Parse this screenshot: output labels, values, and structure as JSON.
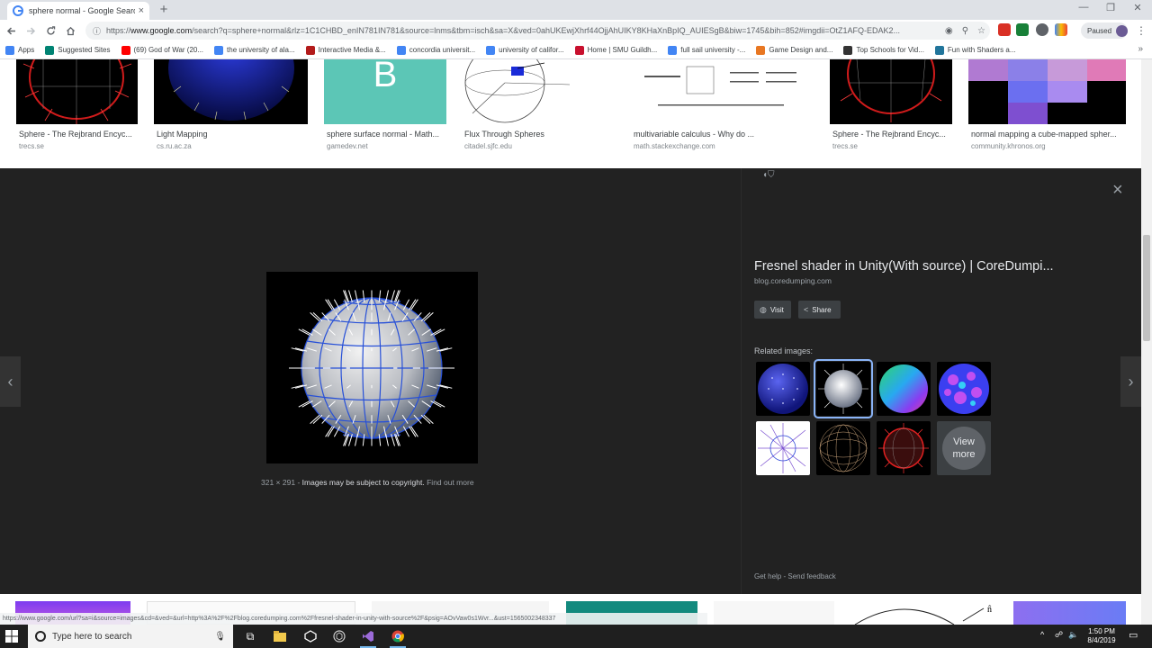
{
  "browser": {
    "tab_title": "sphere normal - Google Search",
    "tab_close": "×",
    "new_tab": "+",
    "window_controls": [
      "—",
      "❐",
      "✕"
    ],
    "url_prefix": "https://",
    "url_domain": "www.google.com",
    "url_rest": "/search?q=sphere+normal&rlz=1C1CHBD_enIN781IN781&source=lnms&tbm=isch&sa=X&ved=0ahUKEwjXhrf44OjjAhUIKY8KHaXnBpIQ_AUIESgB&biw=1745&bih=852#imgdii=OtZ1AFQ-EDAK2...",
    "profile_status": "Paused",
    "menu": "⋮"
  },
  "bookmarks": [
    {
      "label": "Apps",
      "icon": "apps-icon",
      "color": "#4285f4"
    },
    {
      "label": "Suggested Sites",
      "icon": "bing-icon",
      "color": "#008373"
    },
    {
      "label": "(69) God of War (20...",
      "icon": "youtube-icon",
      "color": "#ff0000"
    },
    {
      "label": "the university of ala...",
      "icon": "google-icon",
      "color": "#4285f4"
    },
    {
      "label": "Interactive Media &...",
      "icon": "w-icon",
      "color": "#b31b1b"
    },
    {
      "label": "concordia universit...",
      "icon": "google-icon",
      "color": "#4285f4"
    },
    {
      "label": "university of califor...",
      "icon": "google-icon",
      "color": "#4285f4"
    },
    {
      "label": "Home | SMU Guildh...",
      "icon": "smu-icon",
      "color": "#c8102e"
    },
    {
      "label": "full sail university -...",
      "icon": "google-icon",
      "color": "#4285f4"
    },
    {
      "label": "Game Design and...",
      "icon": "r-icon",
      "color": "#e87722"
    },
    {
      "label": "Top Schools for Vid...",
      "icon": "pen-icon",
      "color": "#333333"
    },
    {
      "label": "Fun with Shaders a...",
      "icon": "wordpress-icon",
      "color": "#21759b"
    }
  ],
  "bookmarks_more": "»",
  "results_top": [
    {
      "title": "Sphere - The Rejbrand Encyc...",
      "source": "trecs.se"
    },
    {
      "title": "Light Mapping",
      "source": "cs.ru.ac.za"
    },
    {
      "title": "sphere surface normal - Math...",
      "source": "gamedev.net"
    },
    {
      "title": "Flux Through Spheres",
      "source": "citadel.sjfc.edu"
    },
    {
      "title": "multivariable calculus - Why do ...",
      "source": "math.stackexchange.com"
    },
    {
      "title": "Sphere - The Rejbrand Encyc...",
      "source": "trecs.se"
    },
    {
      "title": "normal mapping a cube-mapped spher...",
      "source": "community.khronos.org"
    }
  ],
  "viewer": {
    "title": "Fresnel shader in Unity(With source) | CoreDumpi...",
    "site": "blog.coredumping.com",
    "visit_label": "Visit",
    "share_label": "Share",
    "related_label": "Related images:",
    "view_more": "View more",
    "dimensions": "321 × 291",
    "separator": "-",
    "copyright": "Images may be subject to copyright.",
    "find_out_more": "Find out more",
    "get_help": "Get help",
    "dot": "-",
    "send_feedback": "Send feedback",
    "close": "×",
    "prev": "‹",
    "next": "›"
  },
  "status_url": "https://www.google.com/url?sa=i&source=images&cd=&ved=&url=http%3A%2F%2Fblog.coredumping.com%2Ffresnel-shader-in-unity-with-source%2F&psig=AOvVaw0s1Wvr...&ust=1565002348337",
  "taskbar": {
    "search_placeholder": "Type here to search",
    "time": "1:50 PM",
    "date": "8/4/2019"
  }
}
